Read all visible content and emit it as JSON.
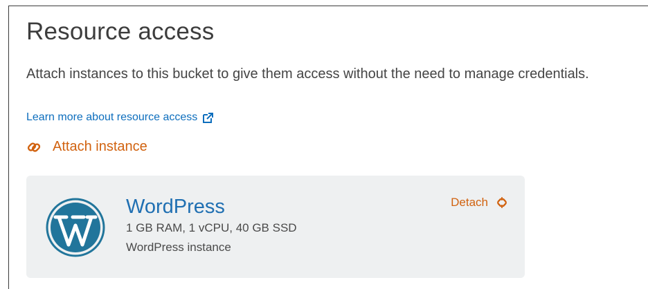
{
  "section": {
    "title": "Resource access",
    "description": "Attach instances to this bucket to give them access without the need to manage credentials.",
    "learn_more_label": "Learn more about resource access",
    "attach_label": "Attach instance"
  },
  "instance_card": {
    "name": "WordPress",
    "specs": "1 GB RAM, 1 vCPU, 40 GB SSD",
    "type": "WordPress instance",
    "detach_label": "Detach",
    "logo_icon": "wordpress-logo"
  },
  "colors": {
    "accent": "#d1620f",
    "link": "#0d6ebd",
    "instance_name": "#1f6fb2",
    "card_background": "#eef0f1"
  },
  "icons": {
    "external_link": "external-link-icon",
    "attach": "attach-link-icon",
    "detach": "detach-link-icon"
  }
}
